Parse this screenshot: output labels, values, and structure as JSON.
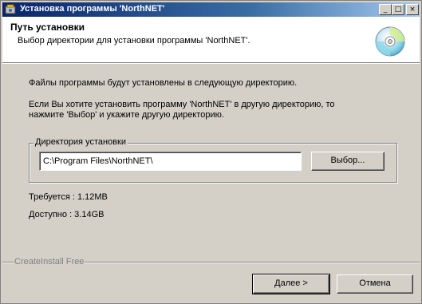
{
  "window": {
    "title": "Установка программы 'NorthNET'",
    "controls": {
      "minimize": "_",
      "maximize": "□",
      "close": "×"
    }
  },
  "header": {
    "title": "Путь установки",
    "subtitle": "Выбор директории для установки программы 'NorthNET'.",
    "icon": "cd-disc-icon"
  },
  "body": {
    "line1": "Файлы программы будут установлены в следующую директорию.",
    "line2": "Если Вы хотите установить программу 'NorthNET' в другую директорию, то",
    "line3": "нажмите 'Выбор' и укажите другую директорию."
  },
  "install_dir": {
    "group_label": "Директория установки",
    "path_value": "C:\\Program Files\\NorthNET\\",
    "browse_label": "Выбор..."
  },
  "space": {
    "required": "Требуется : 1.12MB",
    "available": "Доступно : 3.14GB"
  },
  "footer": {
    "brand": "CreateInstall Free",
    "next_label": "Далее >",
    "cancel_label": "Отмена"
  }
}
